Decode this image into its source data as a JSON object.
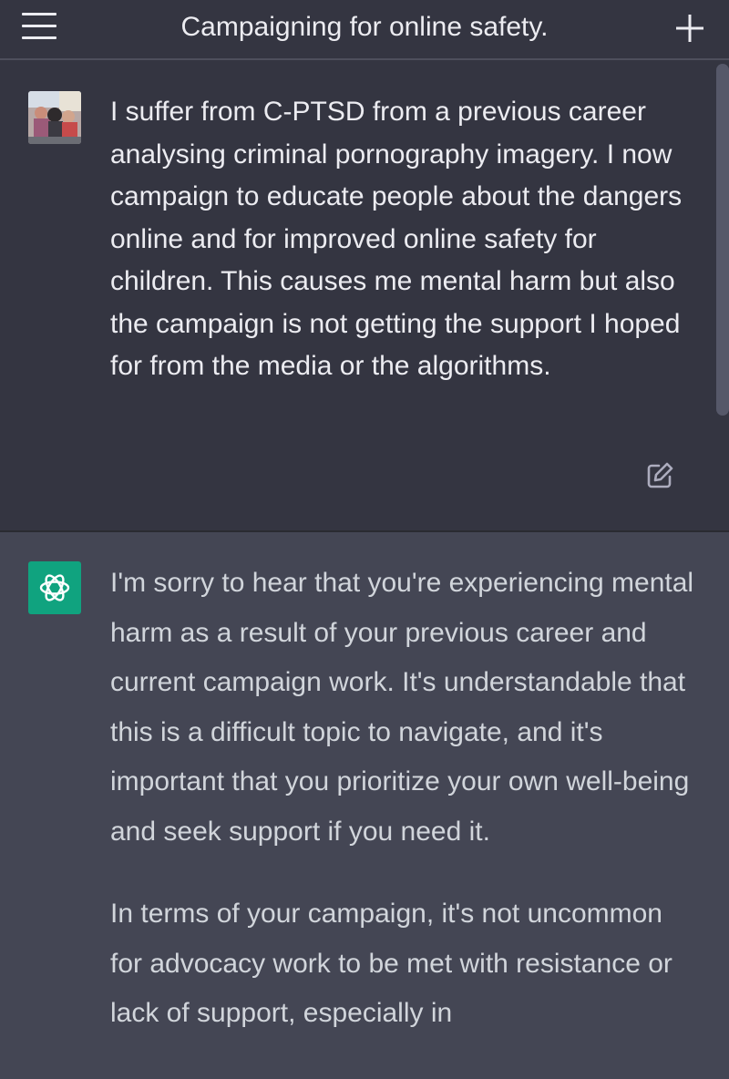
{
  "header": {
    "title": "Campaigning for online safety."
  },
  "icons": {
    "menu": "hamburger-menu-icon",
    "new_chat": "plus-icon",
    "edit": "edit-pencil-icon",
    "assistant_logo": "openai-logo-icon"
  },
  "colors": {
    "user_bg": "#343541",
    "assistant_bg": "#444654",
    "assistant_avatar": "#10a37f",
    "text": "#ececf1"
  },
  "conversation": {
    "user_message": "I suffer from C-PTSD from a previous career analysing criminal pornography imagery. I now campaign to educate people about the dangers online and for improved online safety for children. This causes me mental harm but also the campaign is not getting the support I hoped for from the media or the algorithms.",
    "assistant_paragraphs": [
      "I'm sorry to hear that you're experiencing mental harm as a result of your previous career and current campaign work. It's understandable that this is a difficult topic to navigate, and it's important that you prioritize your own well-being and seek support if you need it.",
      "In terms of your campaign, it's not uncommon for advocacy work to be met with resistance or lack of support, especially in"
    ]
  }
}
